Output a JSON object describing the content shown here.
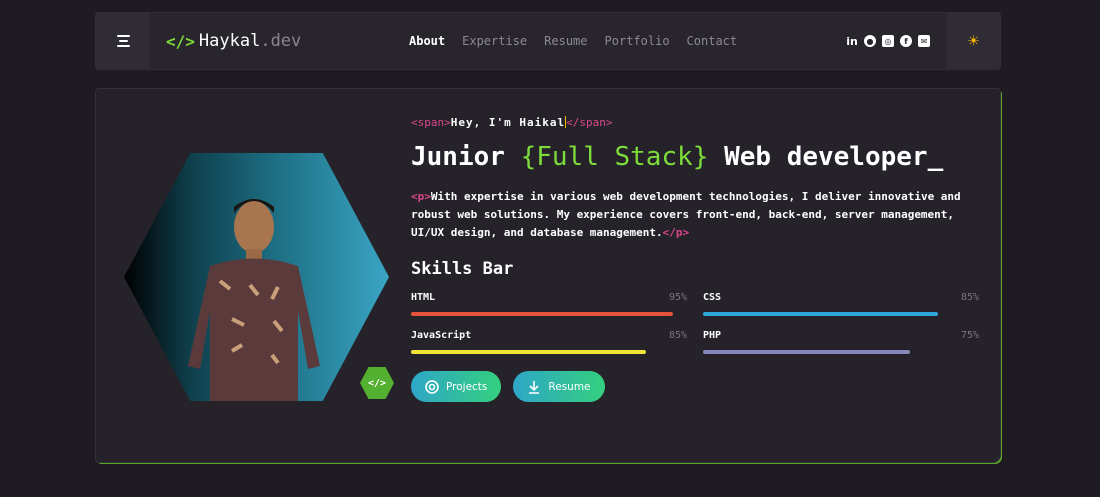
{
  "header": {
    "logo_code": "</>",
    "logo_name": "Haykal",
    "logo_domain": ".dev",
    "nav": [
      "About",
      "Expertise",
      "Resume",
      "Portfolio",
      "Contact"
    ],
    "social": [
      {
        "icon": "linkedin-icon",
        "glyph": "in"
      },
      {
        "icon": "github-icon",
        "glyph": "●"
      },
      {
        "icon": "instagram-icon",
        "glyph": "◎"
      },
      {
        "icon": "facebook-icon",
        "glyph": "f"
      },
      {
        "icon": "mail-icon",
        "glyph": "✉"
      }
    ],
    "theme_glyph": "☀"
  },
  "hero": {
    "open_span": "<span>",
    "greeting": "Hey, I'm Haikal",
    "close_span": "</span>",
    "title_a": "Junior ",
    "title_b": "{Full Stack}",
    "title_c": " Web developer_",
    "open_p": "<p>",
    "description": "With expertise in various web development technologies, I deliver innovative and robust web solutions. My experience covers front-end, back-end, server management, UI/UX design, and database management.",
    "close_p": "</p>",
    "badge": "</>",
    "skills_title": "Skills Bar",
    "skills": [
      {
        "name": "HTML",
        "pct": "95%",
        "value": 95,
        "color": "#e5533a"
      },
      {
        "name": "CSS",
        "pct": "85%",
        "value": 85,
        "color": "#2ea7d8"
      },
      {
        "name": "JavaScript",
        "pct": "85%",
        "value": 85,
        "color": "#f3e53a"
      },
      {
        "name": "PHP",
        "pct": "75%",
        "value": 75,
        "color": "#8587b8"
      }
    ],
    "buttons": {
      "projects": "Projects",
      "resume": "Resume"
    }
  }
}
